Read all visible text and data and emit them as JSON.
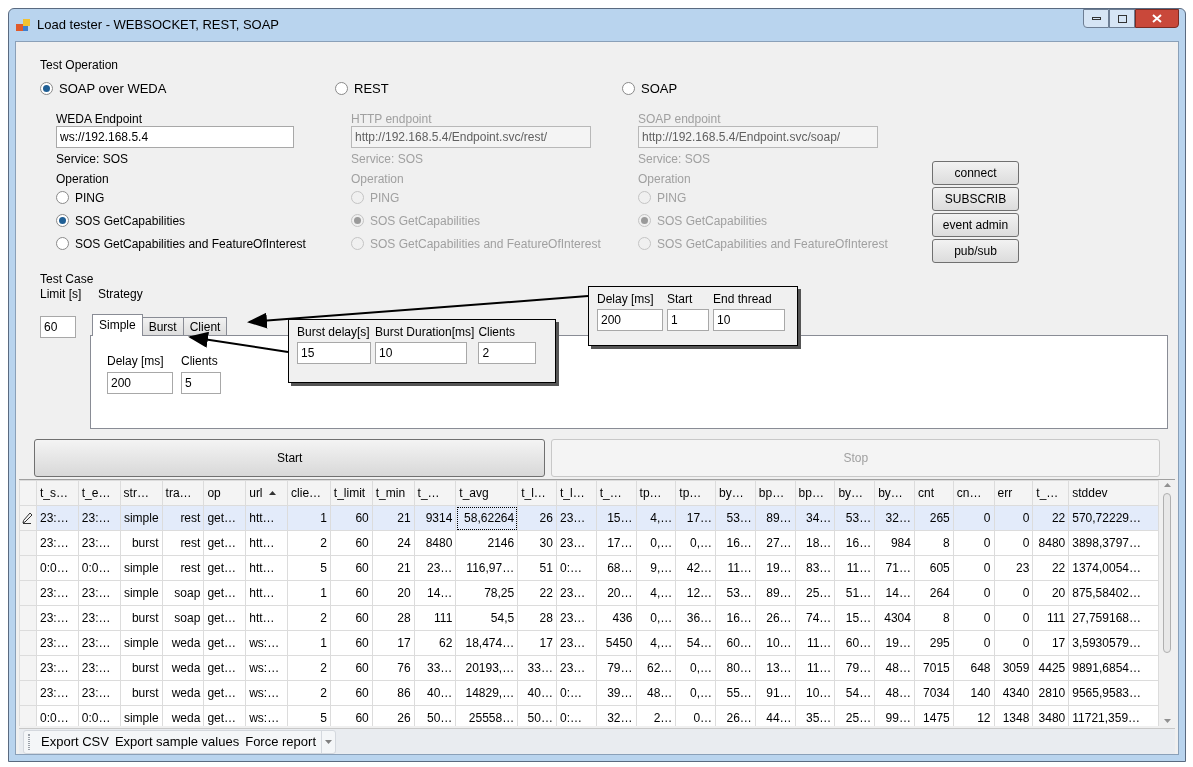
{
  "window": {
    "title": "Load tester - WEBSOCKET, REST, SOAP"
  },
  "test_operation": {
    "title": "Test Operation",
    "transports": [
      {
        "label": "SOAP over WEDA",
        "selected": true,
        "disabled": false,
        "endpoint_label": "WEDA Endpoint",
        "endpoint": "ws://192.168.5.4",
        "service": "Service: SOS",
        "operation_label": "Operation",
        "operations": [
          {
            "label": "PING",
            "selected": false
          },
          {
            "label": "SOS GetCapabilities",
            "selected": true
          },
          {
            "label": "SOS GetCapabilities and FeatureOfInterest",
            "selected": false
          }
        ]
      },
      {
        "label": "REST",
        "selected": false,
        "disabled": true,
        "endpoint_label": "HTTP endpoint",
        "endpoint": "http://192.168.5.4/Endpoint.svc/rest/",
        "service": "Service: SOS",
        "operation_label": "Operation",
        "operations": [
          {
            "label": "PING",
            "selected": false
          },
          {
            "label": "SOS GetCapabilities",
            "selected": true
          },
          {
            "label": "SOS GetCapabilities and FeatureOfInterest",
            "selected": false
          }
        ]
      },
      {
        "label": "SOAP",
        "selected": false,
        "disabled": true,
        "endpoint_label": "SOAP endpoint",
        "endpoint": "http://192.168.5.4/Endpoint.svc/soap/",
        "service": "Service: SOS",
        "operation_label": "Operation",
        "operations": [
          {
            "label": "PING",
            "selected": false
          },
          {
            "label": "SOS GetCapabilities",
            "selected": true
          },
          {
            "label": "SOS GetCapabilities and FeatureOfInterest",
            "selected": false
          }
        ]
      }
    ]
  },
  "side_buttons": [
    "connect",
    "SUBSCRIB",
    "event admin",
    "pub/sub"
  ],
  "test_case": {
    "title": "Test Case",
    "limit_label": "Limit [s]",
    "strategy_label": "Strategy",
    "limit": "60",
    "tabs": [
      {
        "label": "Simple",
        "selected": true
      },
      {
        "label": "Burst",
        "selected": false
      },
      {
        "label": "Client",
        "selected": false
      }
    ],
    "fields": [
      {
        "label": "Delay [ms]",
        "value": "200"
      },
      {
        "label": "Clients",
        "value": "5"
      }
    ]
  },
  "callouts": [
    {
      "fields": [
        {
          "label": "Delay [ms]",
          "value": "200"
        },
        {
          "label": "Start",
          "value": "1"
        },
        {
          "label": "End thread",
          "value": "10"
        }
      ]
    },
    {
      "fields": [
        {
          "label": "Burst delay[s]",
          "value": "15"
        },
        {
          "label": "Burst Duration[ms]",
          "value": "10"
        },
        {
          "label": "Clients",
          "value": "2"
        }
      ]
    }
  ],
  "actions": [
    {
      "label": "Start",
      "disabled": false
    },
    {
      "label": "Stop",
      "disabled": true
    }
  ],
  "table": {
    "columns": [
      {
        "label": "t_s…",
        "sorted": false
      },
      {
        "label": "t_e…",
        "sorted": false
      },
      {
        "label": "str…",
        "sorted": false
      },
      {
        "label": "tra…",
        "sorted": false
      },
      {
        "label": "op",
        "sorted": false
      },
      {
        "label": "url",
        "sorted": true
      },
      {
        "label": "clie…",
        "sorted": false
      },
      {
        "label": "t_limit",
        "sorted": false
      },
      {
        "label": "t_min",
        "sorted": false
      },
      {
        "label": "t_…",
        "sorted": false
      },
      {
        "label": "t_avg",
        "sorted": false
      },
      {
        "label": "t_l…",
        "sorted": false
      },
      {
        "label": "t_l…",
        "sorted": false
      },
      {
        "label": "t_…",
        "sorted": false
      },
      {
        "label": "tp…",
        "sorted": false
      },
      {
        "label": "tp…",
        "sorted": false
      },
      {
        "label": "by…",
        "sorted": false
      },
      {
        "label": "bp…",
        "sorted": false
      },
      {
        "label": "bp…",
        "sorted": false
      },
      {
        "label": "by…",
        "sorted": false
      },
      {
        "label": "by…",
        "sorted": false
      },
      {
        "label": "cnt",
        "sorted": false
      },
      {
        "label": "cn…",
        "sorted": false
      },
      {
        "label": "err",
        "sorted": false
      },
      {
        "label": "t_…",
        "sorted": false
      },
      {
        "label": "stddev",
        "sorted": false
      }
    ],
    "rows": [
      {
        "selected": true,
        "editing": true,
        "cells": [
          "23:…",
          "23:…",
          "simple",
          "rest",
          "get…",
          "htt…",
          "1",
          "60",
          "21",
          "9314",
          "58,62264",
          "26",
          "23…",
          "15…",
          "4,…",
          "17…",
          "53…",
          "89…",
          "34…",
          "53…",
          "32…",
          "265",
          "0",
          "0",
          "22",
          "570,72229…"
        ]
      },
      {
        "selected": false,
        "editing": false,
        "cells": [
          "23:…",
          "23:…",
          "burst",
          "rest",
          "get…",
          "htt…",
          "2",
          "60",
          "24",
          "8480",
          "2146",
          "30",
          "23…",
          "17…",
          "0,…",
          "0,…",
          "16…",
          "27…",
          "18…",
          "16…",
          "984",
          "8",
          "0",
          "0",
          "8480",
          "3898,3797…"
        ]
      },
      {
        "selected": false,
        "editing": false,
        "cells": [
          "0:0…",
          "0:0…",
          "simple",
          "rest",
          "get…",
          "htt…",
          "5",
          "60",
          "21",
          "23…",
          "116,97…",
          "51",
          "0:…",
          "68…",
          "9,…",
          "42…",
          "11…",
          "19…",
          "83…",
          "11…",
          "71…",
          "605",
          "0",
          "23",
          "22",
          "1374,0054…"
        ]
      },
      {
        "selected": false,
        "editing": false,
        "cells": [
          "23:…",
          "23:…",
          "simple",
          "soap",
          "get…",
          "htt…",
          "1",
          "60",
          "20",
          "14…",
          "78,25",
          "22",
          "23…",
          "20…",
          "4,…",
          "12…",
          "53…",
          "89…",
          "25…",
          "51…",
          "14…",
          "264",
          "0",
          "0",
          "20",
          "875,58402…"
        ]
      },
      {
        "selected": false,
        "editing": false,
        "cells": [
          "23:…",
          "23:…",
          "burst",
          "soap",
          "get…",
          "htt…",
          "2",
          "60",
          "28",
          "111",
          "54,5",
          "28",
          "23…",
          "436",
          "0,…",
          "36…",
          "16…",
          "26…",
          "74…",
          "15…",
          "4304",
          "8",
          "0",
          "0",
          "111",
          "27,759168…"
        ]
      },
      {
        "selected": false,
        "editing": false,
        "cells": [
          "23:…",
          "23:…",
          "simple",
          "weda",
          "get…",
          "ws:…",
          "1",
          "60",
          "17",
          "62",
          "18,474…",
          "17",
          "23…",
          "5450",
          "4,…",
          "54…",
          "60…",
          "10…",
          "11…",
          "60…",
          "19…",
          "295",
          "0",
          "0",
          "17",
          "3,5930579…"
        ]
      },
      {
        "selected": false,
        "editing": false,
        "cells": [
          "23:…",
          "23:…",
          "burst",
          "weda",
          "get…",
          "ws:…",
          "2",
          "60",
          "76",
          "33…",
          "20193,…",
          "33…",
          "23…",
          "79…",
          "62…",
          "0,…",
          "80…",
          "13…",
          "11…",
          "79…",
          "48…",
          "7015",
          "648",
          "3059",
          "4425",
          "9891,6854…"
        ]
      },
      {
        "selected": false,
        "editing": false,
        "cells": [
          "23:…",
          "23:…",
          "burst",
          "weda",
          "get…",
          "ws:…",
          "2",
          "60",
          "86",
          "40…",
          "14829,…",
          "40…",
          "0:…",
          "39…",
          "48…",
          "0,…",
          "55…",
          "91…",
          "10…",
          "54…",
          "48…",
          "7034",
          "140",
          "4340",
          "2810",
          "9565,9583…"
        ]
      },
      {
        "selected": false,
        "editing": false,
        "cells": [
          "0:0…",
          "0:0…",
          "simple",
          "weda",
          "get…",
          "ws:…",
          "5",
          "60",
          "26",
          "50…",
          "25558…",
          "50…",
          "0:…",
          "32…",
          "2…",
          "0…",
          "26…",
          "44…",
          "35…",
          "25…",
          "99…",
          "1475",
          "12",
          "1348",
          "3480",
          "11721,359…"
        ]
      }
    ]
  },
  "toolbar": {
    "items": [
      "Export CSV",
      "Export sample values",
      "Force report"
    ]
  }
}
